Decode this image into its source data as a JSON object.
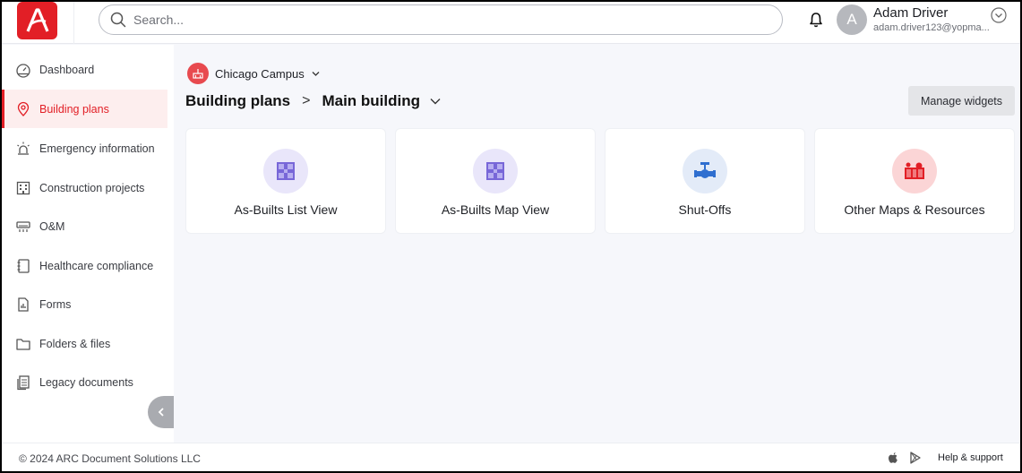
{
  "header": {
    "search_placeholder": "Search...",
    "user_initial": "A",
    "user_name": "Adam Driver",
    "user_email": "adam.driver123@yopma..."
  },
  "sidebar": {
    "items": [
      {
        "label": "Dashboard",
        "icon": "gauge-icon"
      },
      {
        "label": "Building plans",
        "icon": "map-pin-icon",
        "active": true
      },
      {
        "label": "Emergency information",
        "icon": "alarm-icon"
      },
      {
        "label": "Construction projects",
        "icon": "building-icon"
      },
      {
        "label": "O&M",
        "icon": "air-conditioner-icon"
      },
      {
        "label": "Healthcare compliance",
        "icon": "notebook-icon"
      },
      {
        "label": "Forms",
        "icon": "chart-document-icon"
      },
      {
        "label": "Folders & files",
        "icon": "folder-icon"
      },
      {
        "label": "Legacy documents",
        "icon": "documents-icon"
      }
    ]
  },
  "main": {
    "campus": "Chicago Campus",
    "breadcrumb": {
      "parent": "Building plans",
      "separator": ">",
      "current": "Main building"
    },
    "manage_widgets": "Manage widgets",
    "cards": [
      {
        "label": "As-Builts List View",
        "icon": "floor-plan-icon",
        "color": "#e9e6fa"
      },
      {
        "label": "As-Builts Map View",
        "icon": "floor-plan-icon",
        "color": "#e9e6fa"
      },
      {
        "label": "Shut-Offs",
        "icon": "valve-icon",
        "color": "#e3ebf8"
      },
      {
        "label": "Other Maps & Resources",
        "icon": "map-resources-icon",
        "color": "#fbd5d6"
      }
    ]
  },
  "footer": {
    "copyright": "© 2024 ARC Document Solutions LLC",
    "help": "Help & support"
  },
  "colors": {
    "brand": "#e21f26",
    "background": "#f6f7fb",
    "active_nav_bg": "#fdeeee"
  }
}
